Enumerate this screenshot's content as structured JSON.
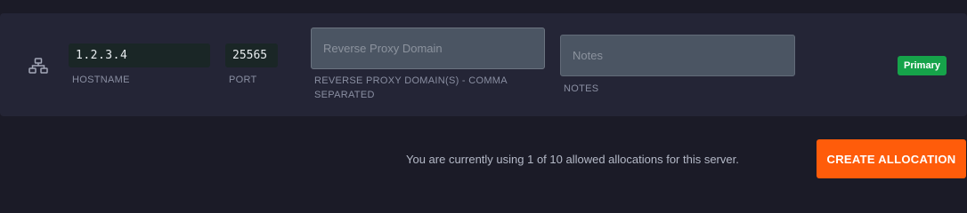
{
  "allocation": {
    "icon": "network-icon",
    "hostname_value": "1.2.3.4",
    "hostname_label": "HOSTNAME",
    "port_value": "25565",
    "port_label": "PORT",
    "proxy_placeholder": "Reverse Proxy Domain",
    "proxy_value": "",
    "proxy_label": "REVERSE PROXY DOMAIN(S) - COMMA SEPARATED",
    "notes_placeholder": "Notes",
    "notes_value": "",
    "notes_label": "NOTES",
    "primary_badge": "Primary"
  },
  "footer": {
    "usage_text": "You are currently using 1 of 10 allowed allocations for this server.",
    "create_button_label": "CREATE ALLOCATION"
  },
  "colors": {
    "background": "#1b1b27",
    "row_background": "#242536",
    "primary_badge": "#16a34a",
    "create_button": "#ff5c0a"
  }
}
